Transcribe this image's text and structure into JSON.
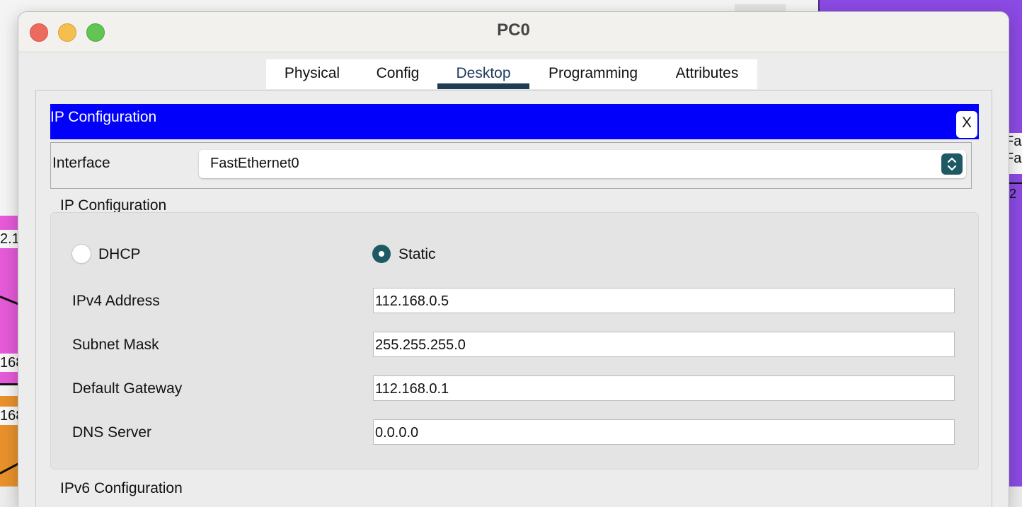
{
  "background": {
    "left_labels": [
      "2.1",
      "168",
      "168"
    ],
    "right_labels": [
      "Fa",
      "Fa"
    ],
    "right_glyph": "2"
  },
  "window": {
    "title": "PC0"
  },
  "tabs": [
    {
      "label": "Physical",
      "active": false
    },
    {
      "label": "Config",
      "active": false
    },
    {
      "label": "Desktop",
      "active": true
    },
    {
      "label": "Programming",
      "active": false
    },
    {
      "label": "Attributes",
      "active": false
    }
  ],
  "ip_config": {
    "header_title": "IP Configuration",
    "close_label": "X",
    "interface": {
      "label": "Interface",
      "value": "FastEthernet0"
    },
    "section_title": "IP Configuration",
    "mode": {
      "dhcp_label": "DHCP",
      "static_label": "Static",
      "selected": "Static"
    },
    "fields": {
      "ipv4_label": "IPv4 Address",
      "ipv4_value": "112.168.0.5",
      "subnet_label": "Subnet Mask",
      "subnet_value": "255.255.255.0",
      "gateway_label": "Default Gateway",
      "gateway_value": "112.168.0.1",
      "dns_label": "DNS Server",
      "dns_value": "0.0.0.0"
    },
    "ipv6_section_title": "IPv6 Configuration"
  },
  "colors": {
    "header_blue": "#0000fb",
    "accent_teal": "#1d5a63",
    "tab_underline": "#1e3d55"
  }
}
